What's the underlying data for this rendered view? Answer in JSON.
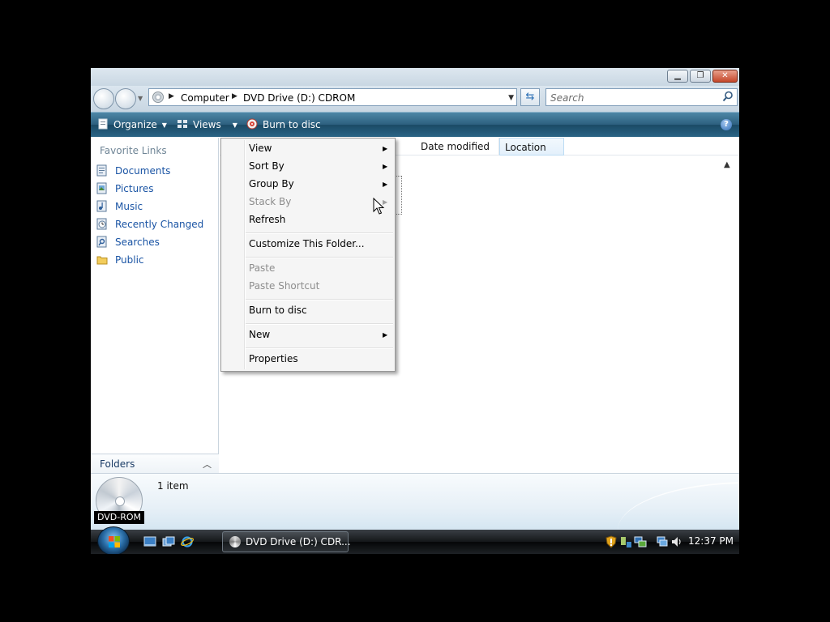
{
  "window": {
    "title_buttons": {
      "minimize": "minimize-icon",
      "maximize": "maximize-icon",
      "close": "close-icon"
    }
  },
  "navbar": {
    "breadcrumbs": [
      "Computer",
      "DVD Drive (D:) CDROM"
    ],
    "search_placeholder": "Search"
  },
  "commandbar": {
    "organize": "Organize",
    "views": "Views",
    "burn": "Burn to disc"
  },
  "navpane": {
    "heading": "Favorite Links",
    "items": [
      {
        "label": "Documents",
        "icon": "documents-icon"
      },
      {
        "label": "Pictures",
        "icon": "pictures-icon"
      },
      {
        "label": "Music",
        "icon": "music-icon"
      },
      {
        "label": "Recently Changed",
        "icon": "recently-changed-icon"
      },
      {
        "label": "Searches",
        "icon": "searches-icon"
      },
      {
        "label": "Public",
        "icon": "public-folder-icon"
      }
    ],
    "folders_label": "Folders"
  },
  "content": {
    "columns": [
      "Date modified",
      "Location"
    ]
  },
  "details": {
    "drive_label": "DVD-ROM",
    "item_count": "1 item"
  },
  "taskbar": {
    "task_label": "DVD Drive (D:) CDR...",
    "clock": "12:37 PM"
  },
  "context_menu": {
    "items": [
      {
        "label": "View",
        "submenu": true,
        "disabled": false
      },
      {
        "label": "Sort By",
        "submenu": true,
        "disabled": false
      },
      {
        "label": "Group By",
        "submenu": true,
        "disabled": false
      },
      {
        "label": "Stack By",
        "submenu": true,
        "disabled": true
      },
      {
        "label": "Refresh",
        "submenu": false,
        "disabled": false
      },
      {
        "label": "Customize This Folder...",
        "submenu": false,
        "disabled": false
      },
      {
        "label": "Paste",
        "submenu": false,
        "disabled": true
      },
      {
        "label": "Paste Shortcut",
        "submenu": false,
        "disabled": true
      },
      {
        "label": "Burn to disc",
        "submenu": false,
        "disabled": false
      },
      {
        "label": "New",
        "submenu": true,
        "disabled": false
      },
      {
        "label": "Properties",
        "submenu": false,
        "disabled": false
      }
    ]
  },
  "colors": {
    "commandbar": "#2c5f7e",
    "link": "#1a54a4",
    "disabled_text": "#8d8d8d"
  }
}
